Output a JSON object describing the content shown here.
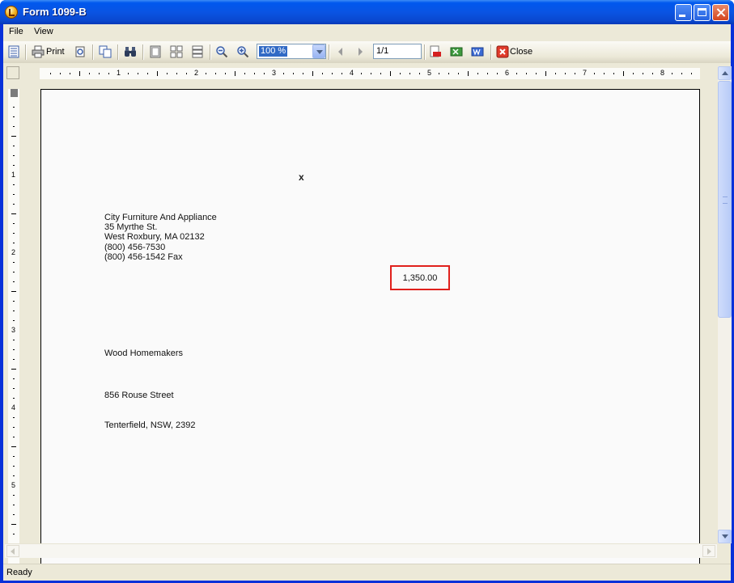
{
  "window": {
    "title": "Form 1099-B",
    "accent": "#0a54e3"
  },
  "menu": {
    "items": [
      "File",
      "View"
    ]
  },
  "toolbar": {
    "print_label": "Print",
    "zoom_value": "100 %",
    "page_value": "1/1",
    "close_label": "Close"
  },
  "ruler": {
    "h_numbers": [
      "1",
      "2",
      "3",
      "4",
      "5",
      "6",
      "7",
      "8"
    ],
    "v_numbers": [
      "1",
      "2",
      "3",
      "4",
      "5"
    ]
  },
  "document": {
    "mark": "x",
    "payer": {
      "name": "City Furniture And Appliance",
      "street": "35 Myrthe St.",
      "city": "West Roxbury,  MA  02132",
      "phone": "(800) 456-7530",
      "fax": "(800) 456-1542 Fax"
    },
    "amount": "1,350.00",
    "amount_box_color": "#e0201c",
    "recipient": {
      "name": "Wood Homemakers",
      "street": "856 Rouse Street",
      "city": "Tenterfield, NSW, 2392"
    }
  },
  "status": {
    "text": "Ready"
  }
}
